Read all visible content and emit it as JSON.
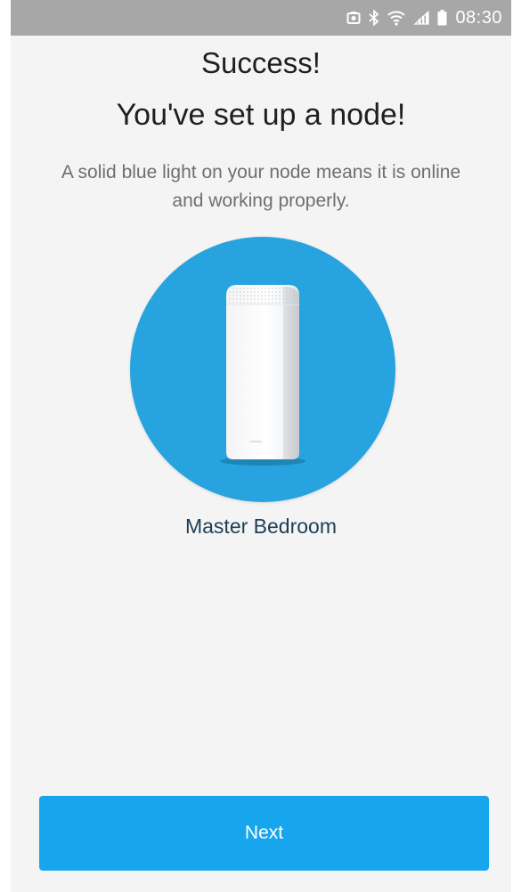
{
  "status_bar": {
    "time": "08:30",
    "icons": [
      "photo-notification-icon",
      "bluetooth-icon",
      "wifi-icon",
      "signal-icon",
      "battery-icon"
    ]
  },
  "content": {
    "title": "Success!",
    "subtitle": "You've set up a node!",
    "description": "A solid blue light on your node means it is online and working properly.",
    "node_name": "Master Bedroom"
  },
  "actions": {
    "next_label": "Next"
  },
  "colors": {
    "status_bar": "#a7a7a7",
    "background": "#f4f4f4",
    "circle": "#27a3e0",
    "button": "#17a5ed",
    "node_name_text": "#1e3e55"
  }
}
